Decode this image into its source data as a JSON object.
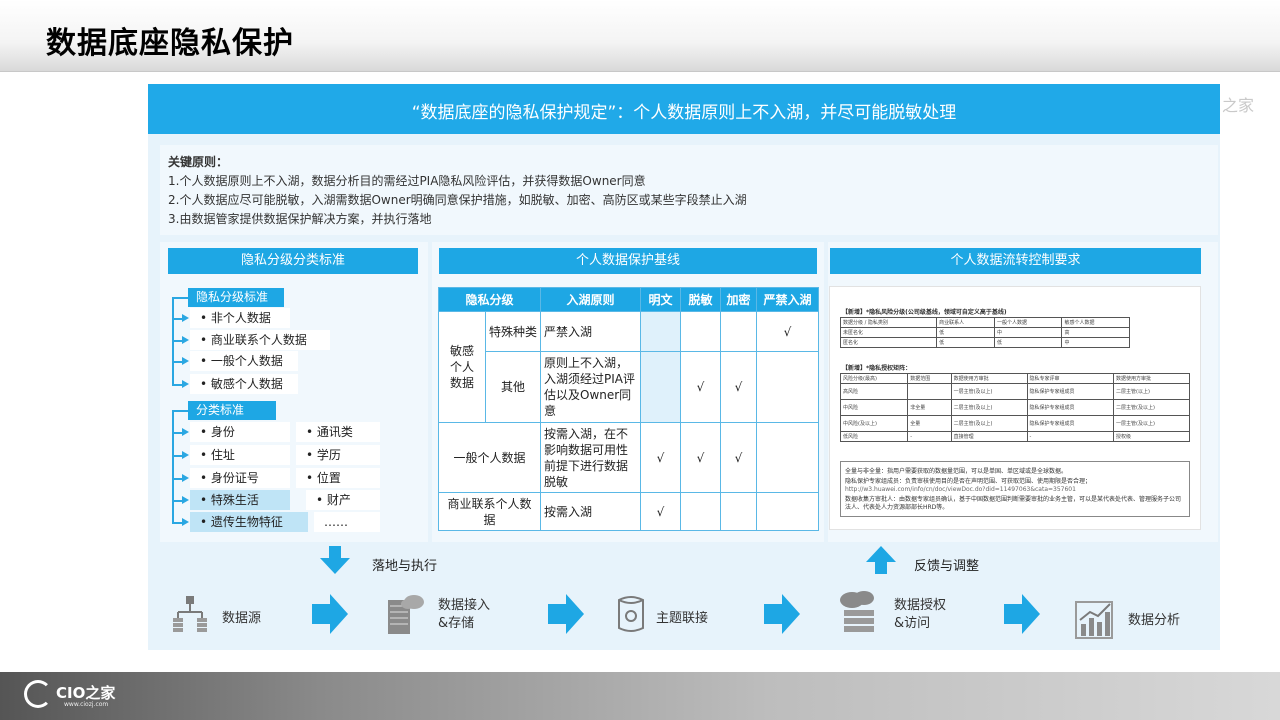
{
  "page": {
    "title": "数据底座隐私保护"
  },
  "watermark": "之家",
  "banner": {
    "text": "“数据底座的隐私保护规定”：个人数据原则上不入湖，并尽可能脱敏处理"
  },
  "principles": {
    "title": "关键原则：",
    "items": [
      "1.个人数据原则上不入湖，数据分析目的需经过PIA隐私风险评估，并获得数据Owner同意",
      "2.个人数据应尽可能脱敏，入湖需数据Owner明确同意保护措施，如脱敏、加密、高防区或某些字段禁止入湖",
      "3.由数据管家提供数据保护解决方案，并执行落地"
    ]
  },
  "classification": {
    "header": "隐私分级分类标准",
    "levels_title": "隐私分级标准",
    "levels": [
      "• 非个人数据",
      "• 商业联系个人数据",
      "• 一般个人数据",
      "• 敏感个人数据"
    ],
    "categories_title": "分类标准",
    "categories_left": [
      "• 身份",
      "• 住址",
      "• 身份证号",
      "• 特殊生活",
      "• 遗传生物特征"
    ],
    "categories_right": [
      "• 通讯类",
      "• 学历",
      "• 位置",
      "• 财产",
      "……"
    ]
  },
  "baseline": {
    "header": "个人数据保护基线",
    "columns": [
      "隐私分级",
      "入湖原则",
      "明文",
      "脱敏",
      "加密",
      "严禁入湖"
    ],
    "sensitive_label": "敏感\n个人\n数据",
    "rows": [
      {
        "sub": "特殊种类",
        "principle": "严禁入湖",
        "plain": "",
        "desens": "",
        "encrypt": "",
        "ban": "√"
      },
      {
        "sub": "其他",
        "principle": "原则上不入湖，入湖须经过PIA评估以及Owner同意",
        "plain": "",
        "desens": "√",
        "encrypt": "√",
        "ban": ""
      },
      {
        "level": "一般个人数据",
        "principle": "按需入湖，在不影响数据可用性前提下进行数据脱敏",
        "plain": "√",
        "desens": "√",
        "encrypt": "√",
        "ban": ""
      },
      {
        "level": "商业联系个人数据",
        "principle": "按需入湖",
        "plain": "√",
        "desens": "",
        "encrypt": "",
        "ban": ""
      }
    ]
  },
  "flow_control": {
    "header": "个人数据流转控制要求",
    "doc_title1": "【新增】*隐私风险分级(公司级基线，领域可自定义高于基线)",
    "t1_headers": [
      "数据分级 / 隐私类别",
      "商业联系人",
      "一般个人数据",
      "敏感个人数据"
    ],
    "t1_rows": [
      [
        "未匿名化",
        "低",
        "中",
        "高"
      ],
      [
        "匿名化",
        "低",
        "低",
        "中"
      ]
    ],
    "doc_title2": "【新增】*隐私授权矩阵：",
    "t2_headers": [
      "风险分级(最高)",
      "数据范围",
      "数据使用方审批",
      "隐私专家评审",
      "数据使用方审批"
    ],
    "t2_rows": [
      [
        "高风险",
        "",
        "一层主管(及以上)",
        "隐私保护专家组成员",
        "二层主管(以上)"
      ],
      [
        "中风险",
        "非全量",
        "二层主管(及以上)",
        "隐私保护专家组成员",
        "二层主管(及以上)"
      ],
      [
        "中风险(及以上)",
        "全量",
        "二层主管(及以上)",
        "隐私保护专家组成员",
        "一层主管(及以上)"
      ],
      [
        "低风险",
        "-",
        "直接管理",
        "-",
        "授权级"
      ]
    ],
    "note1": "全量与非全量：指用户需要获取的数据量范围，可以是单国、单区域或是全球数据。",
    "note2": "隐私保护专家组成员：负责审核使用目的是否在声明范围、可获取范围、使用期限是否合理；",
    "note3": "http://w3.huawei.com/info/cn/doc/viewDoc.do?did=11497063&cata=357601",
    "note4": "数据收集方审批人：由数据专家组员确认，基于中国数据范围判断需要审批的业务主管，可以是某代表处代表、管理服务子公司法人、代表处人力资源部部长HRD等。"
  },
  "arrows": {
    "down_label": "落地与执行",
    "up_label": "反馈与调整"
  },
  "flow_steps": [
    {
      "icon": "network-icon",
      "label": "数据源"
    },
    {
      "icon": "server-icon",
      "label": "数据接入\n&存储"
    },
    {
      "icon": "database-icon",
      "label": "主题联接"
    },
    {
      "icon": "cloud-server-icon",
      "label": "数据授权\n&访问"
    },
    {
      "icon": "bar-chart-icon",
      "label": "数据分析"
    }
  ],
  "footer": {
    "logo_text": "CIO之家",
    "logo_url": "www.ciozj.com"
  },
  "colors": {
    "accent": "#1ea7e4",
    "panel": "#e7f3fb",
    "highlight": "#bfe4f6"
  }
}
